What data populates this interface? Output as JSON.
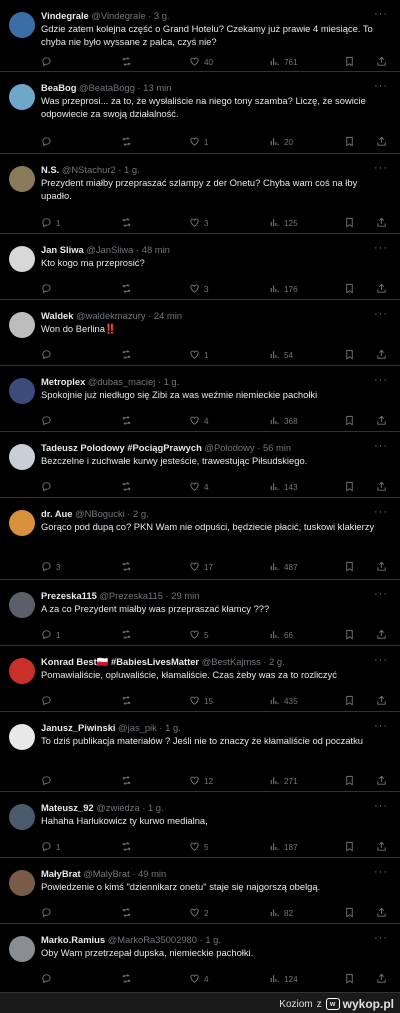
{
  "icons": {
    "reply": "reply-icon",
    "retweet": "retweet-icon",
    "like": "heart-icon",
    "views": "views-icon",
    "bookmark": "bookmark-icon",
    "share": "share-icon",
    "more": "more-icon"
  },
  "tweets": [
    {
      "name": "Vindegrale",
      "handle": "@Vindegrale",
      "time": "3 g.",
      "text": "Gdzie zatem kolejna część o Grand Hotelu? Czekamy już prawie 4 miesiące. To chyba nie było wyssane z palca, czyś nie?",
      "replies": "",
      "retweets": "",
      "likes": "40",
      "views": "761",
      "avatar": "#3a6ea5"
    },
    {
      "name": "BeaBog",
      "handle": "@BeataBogg",
      "time": "13 min",
      "text": "Was przeprosi... za to, że wysłaliście na niego tony szamba? Liczę, że sowicie odpowiecie za swoją działalność.",
      "replies": "",
      "retweets": "",
      "likes": "1",
      "views": "20",
      "avatar": "#6fa7c9"
    },
    {
      "name": "N.S.",
      "handle": "@NStachur2",
      "time": "1 g.",
      "text": "Prezydent miałby przepraszać szlampy z der Onetu? Chyba wam coś na łby upadło.",
      "replies": "1",
      "retweets": "",
      "likes": "3",
      "views": "125",
      "avatar": "#8a7a5c"
    },
    {
      "name": "Jan Sliwa",
      "handle": "@JanSliwa",
      "time": "48 min",
      "text": "Kto kogo ma przeprosić?",
      "replies": "",
      "retweets": "",
      "likes": "3",
      "views": "176",
      "avatar": "#d8d8d8"
    },
    {
      "name": "Waldek",
      "handle": "@waldekmazury",
      "time": "24 min",
      "text": "Won do Berlina‼️",
      "replies": "",
      "retweets": "",
      "likes": "1",
      "views": "54",
      "avatar": "#bdbdbd"
    },
    {
      "name": "Metroplex",
      "handle": "@dubas_maciej",
      "time": "1 g.",
      "text": "Spokojnie już niedługo się Zibi za was weźmie niemieckie pachołki",
      "replies": "",
      "retweets": "",
      "likes": "4",
      "views": "368",
      "avatar": "#3b4b7a"
    },
    {
      "name": "Tadeusz Polodowy #PociągPrawych",
      "handle": "@Polodowy",
      "time": "56 min",
      "text": "Bezczelne i zuchwałe kurwy jesteście, trawestując Piłsudskiego.",
      "replies": "",
      "retweets": "",
      "likes": "4",
      "views": "143",
      "avatar": "#c9cfd6"
    },
    {
      "name": "dr. Aue",
      "handle": "@NBogucki",
      "time": "2 g.",
      "text": "Gorąco pod dupą co? PKN Wam nie odpuści, będziecie płacić, tuskowi klakierzy",
      "replies": "3",
      "retweets": "",
      "likes": "17",
      "views": "487",
      "avatar": "#d9903a"
    },
    {
      "name": "Prezeska115",
      "handle": "@Prezeska115",
      "time": "29 min",
      "text": "A za co Prezydent miałby was przepraszać kłamcy ???",
      "replies": "1",
      "retweets": "",
      "likes": "5",
      "views": "66",
      "avatar": "#5a5f6a"
    },
    {
      "name": "Konrad Best🇵🇱 #BabiesLivesMatter",
      "handle": "@BestKajmss",
      "time": "2 g.",
      "text": "Pomawialiście, opluwaliście, kłamaliście. Czas żeby was  za to rozliczyć",
      "replies": "",
      "retweets": "",
      "likes": "15",
      "views": "435",
      "avatar": "#c8302a"
    },
    {
      "name": "Janusz_Piwinski",
      "handle": "@jas_pik",
      "time": "1 g.",
      "text": "To dziś publikacja materiałów ? Jeśli nie to znaczy że kłamaliście od poczatku",
      "replies": "",
      "retweets": "",
      "likes": "12",
      "views": "271",
      "avatar": "#e8e8e8"
    },
    {
      "name": "Mateusz_92",
      "handle": "@zwiedza",
      "time": "1 g.",
      "text": "Hahaha Harłukowicz ty kurwo medialna,",
      "replies": "1",
      "retweets": "",
      "likes": "5",
      "views": "187",
      "avatar": "#4c5a6e"
    },
    {
      "name": "MałyBrat",
      "handle": "@MalyBrat",
      "time": "49 min",
      "text": "Powiedzenie o kimś \"dziennikarz onetu\" staje się najgorszą obelgą.",
      "replies": "",
      "retweets": "",
      "likes": "2",
      "views": "82",
      "avatar": "#7a5a48"
    },
    {
      "name": "Marko.Ramius",
      "handle": "@MarkoRa35002980",
      "time": "1 g.",
      "text": "Oby Wam przetrzepał dupska, niemieckie pachołki.",
      "replies": "",
      "retweets": "",
      "likes": "4",
      "views": "124",
      "avatar": "#8a8d92"
    }
  ],
  "footer": {
    "credit": "Koziom",
    "z": "z",
    "site": "wykop.pl",
    "logo_mark": "w"
  }
}
